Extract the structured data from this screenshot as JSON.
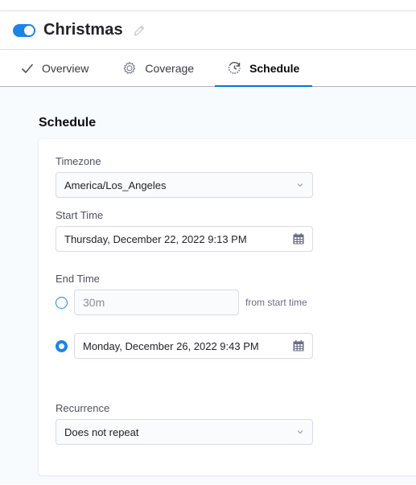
{
  "header": {
    "title": "Christmas",
    "enabled": true
  },
  "tabs": [
    {
      "label": "Overview",
      "icon": "check-icon",
      "active": false
    },
    {
      "label": "Coverage",
      "icon": "gear-icon",
      "active": false
    },
    {
      "label": "Schedule",
      "icon": "schedule-refresh-icon",
      "active": true
    }
  ],
  "schedule": {
    "section_title": "Schedule",
    "timezone": {
      "label": "Timezone",
      "value": "America/Los_Angeles"
    },
    "start_time": {
      "label": "Start Time",
      "value": "Thursday, December 22, 2022 9:13 PM"
    },
    "end_time": {
      "label": "End Time",
      "duration_option": {
        "placeholder": "30m",
        "suffix": "from start time",
        "selected": false
      },
      "datetime_option": {
        "value": "Monday, December 26, 2022 9:43 PM",
        "selected": true
      }
    },
    "recurrence": {
      "label": "Recurrence",
      "value": "Does not repeat"
    }
  },
  "colors": {
    "accent": "#1b84e8",
    "tab_underline": "#0278d5"
  }
}
